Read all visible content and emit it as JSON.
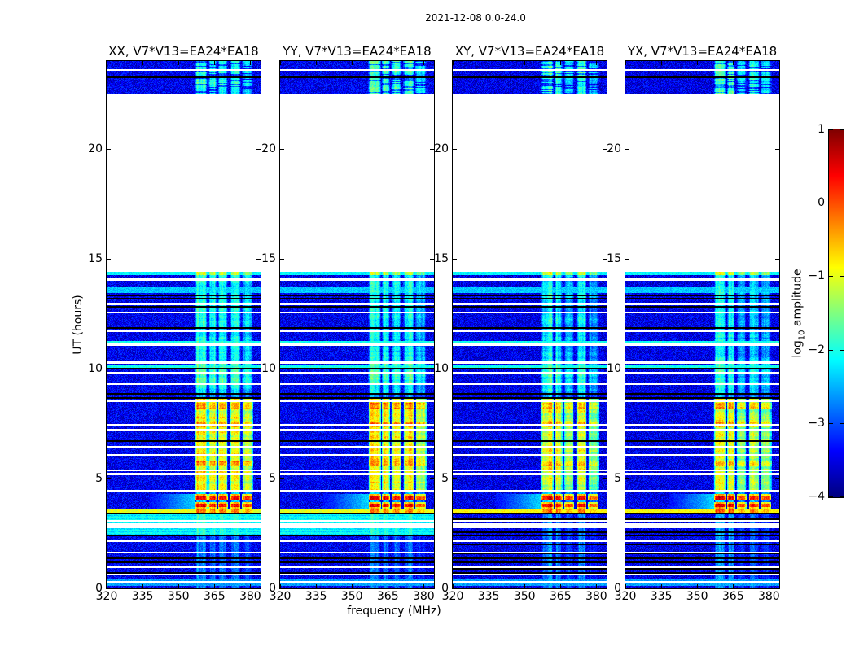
{
  "figure": {
    "title": "2021-12-08 0.0-24.0",
    "xlabel": "frequency (MHz)",
    "ylabel": "UT (hours)",
    "colorbar_label": {
      "prefix": "log",
      "sub": "10",
      "suffix": " amplitude"
    }
  },
  "chart_data": {
    "type": "heatmap",
    "title": "2021-12-08 0.0-24.0",
    "xlabel": "frequency (MHz)",
    "ylabel": "UT (hours)",
    "colormap": "jet",
    "panels": [
      {
        "pol": "XX",
        "title": "XX, V7*V13=EA24*EA18"
      },
      {
        "pol": "YY",
        "title": "YY, V7*V13=EA24*EA18"
      },
      {
        "pol": "XY",
        "title": "XY, V7*V13=EA24*EA18"
      },
      {
        "pol": "YX",
        "title": "YX, V7*V13=EA24*EA18"
      }
    ],
    "x_range_mhz": [
      320,
      384.3
    ],
    "x_ticks": [
      "320",
      "335",
      "350",
      "365",
      "380"
    ],
    "x_tick_values": [
      320,
      335,
      350,
      365,
      380
    ],
    "y_range_hours": [
      0,
      24
    ],
    "y_ticks": [
      "0",
      "5",
      "10",
      "15",
      "20"
    ],
    "y_tick_values": [
      0,
      5,
      10,
      15,
      20
    ],
    "colorbar": {
      "label": "log10 amplitude",
      "range": [
        -4,
        1
      ],
      "ticks": [
        "1",
        "0",
        "−1",
        "−2",
        "−3",
        "−4"
      ],
      "tick_values": [
        1,
        0,
        -1,
        -2,
        -3,
        -4
      ]
    },
    "data_bands_ut": [
      [
        0,
        14.42
      ],
      [
        22.5,
        24
      ]
    ],
    "no_data_ut": [
      14.42,
      22.5
    ],
    "rfi_columns_mhz": [
      [
        357.3,
        361.8
      ],
      [
        362.8,
        365.6
      ],
      [
        366.8,
        370.3
      ],
      [
        371.8,
        375.7
      ],
      [
        376.8,
        380.8
      ]
    ],
    "rfi_column_strengths": [
      1.0,
      0.95,
      0.85,
      0.95,
      0.7
    ],
    "events": {
      "base_level": -3.45,
      "weak_cols_level": -2.75,
      "cyan_band_ut": [
        2.45,
        3.38
      ],
      "cyan_band_level": -2.18,
      "cyan_band_pols": [
        "XX",
        "YY"
      ],
      "flare_line_ut": [
        3.45,
        3.58
      ],
      "flare_level": -1.0,
      "strong_blocks_ut": [
        3.62,
        4.28
      ],
      "strong_blocks_level": 0.4,
      "blocks_gap_ut": [
        3.93,
        3.99
      ],
      "strong_cols_ut": [
        4.5,
        8.62
      ],
      "strong_cols_level": -0.85,
      "moderate_cols_ut": [
        8.9,
        14.25
      ],
      "moderate_cols_level": -2.0,
      "edge_row_ut": [
        14.25,
        14.42
      ],
      "edge_row_level": -2.15,
      "top_band_ut": [
        22.5,
        24
      ],
      "top_band_cols_level": -1.9,
      "bottom_cyan_rows_ut": [
        0.12,
        0.42
      ],
      "cyan_rows_ut": [
        10.1,
        11.2,
        13.55
      ],
      "cyan_stripe_ut": [
        13.45,
        13.72
      ],
      "orange_rows_ut": [
        5.7,
        7.45,
        8.3
      ],
      "white_lines_ut": [
        0.3,
        0.62,
        0.98,
        1.63,
        2.15,
        2.78,
        2.9,
        3.05,
        4.44,
        5.2,
        5.38,
        6.07,
        6.42,
        7.2,
        7.45,
        8.52,
        9.3,
        9.8,
        10.28,
        11.1,
        11.72,
        12.55,
        12.95,
        14.05,
        23.6
      ],
      "black_lines_ut": [
        0.7,
        1.18,
        1.36,
        2.42,
        3.41,
        6.72,
        8.68,
        8.84,
        10.02,
        11.85,
        12.82,
        13.2,
        13.34,
        23.27
      ],
      "black_lines_xpol_ut": [
        0.88,
        1.6,
        1.98,
        2.55,
        3.14
      ]
    }
  }
}
